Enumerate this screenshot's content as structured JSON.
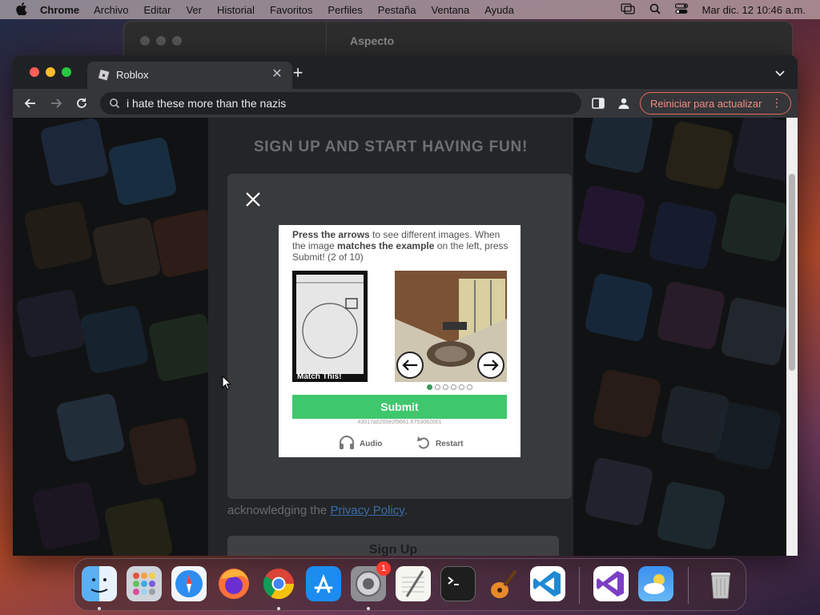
{
  "menubar": {
    "app_name": "Chrome",
    "items": [
      "Archivo",
      "Editar",
      "Ver",
      "Historial",
      "Favoritos",
      "Perfiles",
      "Pestaña",
      "Ventana",
      "Ayuda"
    ],
    "clock": "Mar dic. 12  10:46 a.m."
  },
  "background_window": {
    "title": "Aspecto"
  },
  "browser": {
    "tab": {
      "title": "Roblox"
    },
    "omnibox": {
      "text": "i hate these more than the nazis"
    },
    "update_button": {
      "label": "Reiniciar para actualizar"
    }
  },
  "page": {
    "heading": "SIGN UP AND START HAVING FUN!",
    "privacy": {
      "prefix": "acknowledging the ",
      "link": "Privacy Policy",
      "suffix": "."
    },
    "signup_button": "Sign Up"
  },
  "captcha": {
    "instructions": {
      "part1": "Press the arrows",
      "part2": " to see different images. When the image ",
      "part3": "matches the example",
      "part4": " on the left, press Submit! (2 of 10)"
    },
    "example_label": "Match This!",
    "pager": {
      "total": 6,
      "active_index": 0
    },
    "submit_label": "Submit",
    "session_id": "43017a0200e2f9661.6753062001",
    "audio_label": "Audio",
    "restart_label": "Restart"
  },
  "dock": {
    "apps": [
      "finder-icon",
      "launchpad-icon",
      "safari-icon",
      "firefox-icon",
      "chrome-icon",
      "app-store-icon",
      "system-settings-icon",
      "textedit-icon",
      "terminal-icon",
      "garageband-icon",
      "vscode-icon",
      "visual-studio-icon",
      "weather-icon",
      "trash-icon"
    ],
    "system_settings_badge": "1"
  },
  "colors": {
    "submit_green": "#3fc76d",
    "link_blue": "#3a6da8",
    "update_red": "#f28b82"
  }
}
